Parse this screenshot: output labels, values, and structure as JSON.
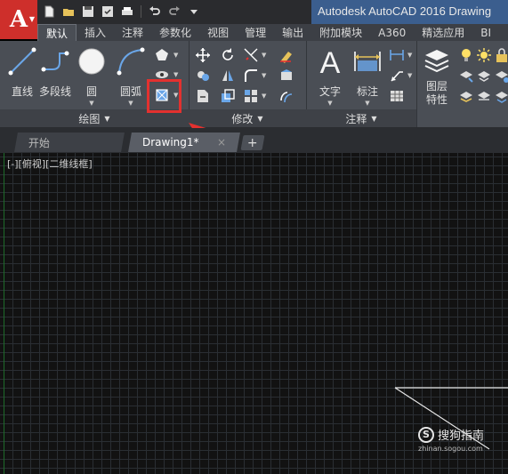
{
  "window": {
    "title": "Autodesk AutoCAD 2016    Drawing",
    "app_logo": "A"
  },
  "ribbon_tabs": [
    "默认",
    "插入",
    "注释",
    "参数化",
    "视图",
    "管理",
    "输出",
    "附加模块",
    "A360",
    "精选应用",
    "BI"
  ],
  "active_tab": "默认",
  "draw_panel": {
    "tools": {
      "line": "直线",
      "polyline": "多段线",
      "circle": "圆",
      "arc": "圆弧"
    },
    "footer": "绘图"
  },
  "modify_panel": {
    "footer": "修改"
  },
  "annotation_panel": {
    "text": "文字",
    "dimension": "标注",
    "footer": "注释"
  },
  "layers_panel": {
    "properties_line1": "图层",
    "properties_line2": "特性"
  },
  "doc_tabs": {
    "start": "开始",
    "drawing": "Drawing1*",
    "close": "×",
    "new": "+"
  },
  "canvas": {
    "viewport_label": "[-][俯视][二维线框]"
  },
  "watermark": {
    "logo": "S",
    "text": "搜狗指南",
    "url": "zhinan.sogou.com"
  },
  "colors": {
    "highlight": "#e3312f",
    "app_button": "#ce2f2b",
    "ribbon": "#4a4e55",
    "canvas": "#121212"
  }
}
